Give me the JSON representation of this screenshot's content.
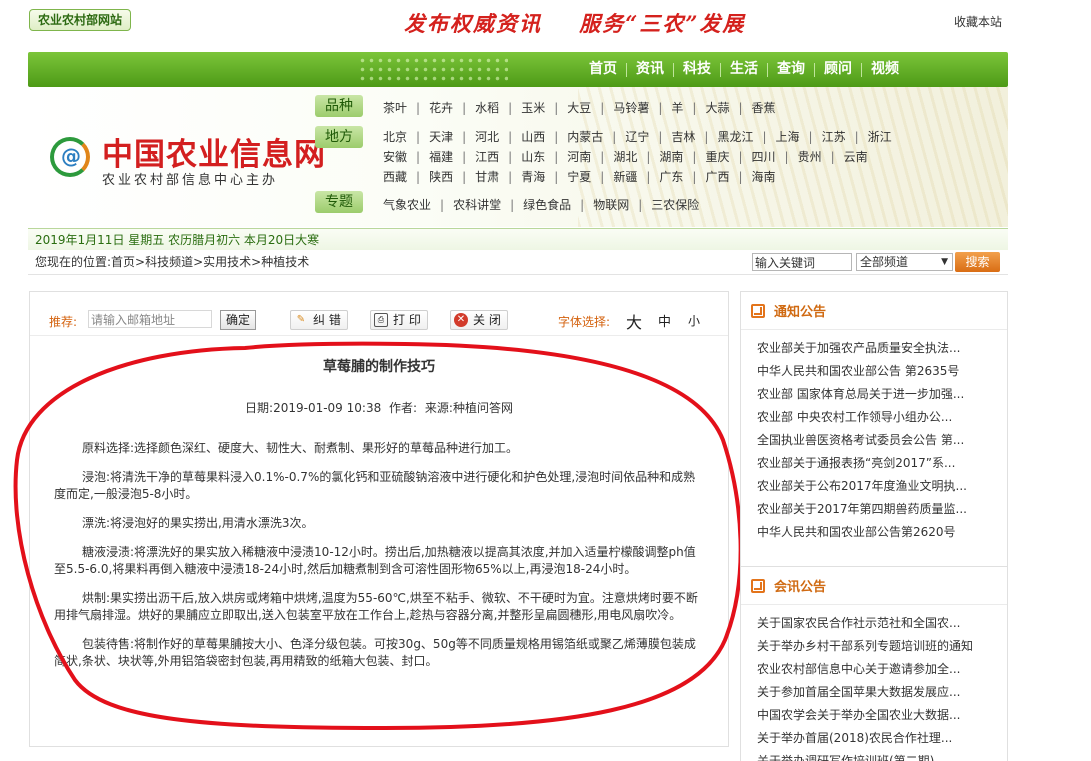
{
  "top": {
    "ministry_link": "农业农村部网站",
    "slogan": "发布权威资讯    服务“三农”发展",
    "bookmark": "收藏本站"
  },
  "nav": [
    "首页",
    "资讯",
    "科技",
    "生活",
    "查询",
    "顾问",
    "视频"
  ],
  "logo": {
    "mark": "@",
    "title": "中国农业信息网",
    "subtitle": "农业农村部信息中心主办"
  },
  "categories": {
    "variety_label": "品种",
    "variety": [
      "茶叶",
      "花卉",
      "水稻",
      "玉米",
      "大豆",
      "马铃薯",
      "羊",
      "大蒜",
      "香蕉"
    ],
    "region_label": "地方",
    "region_row1": [
      "北京",
      "天津",
      "河北",
      "山西",
      "内蒙古",
      "辽宁",
      "吉林",
      "黑龙江",
      "上海",
      "江苏",
      "浙江"
    ],
    "region_row2": [
      "安徽",
      "福建",
      "江西",
      "山东",
      "河南",
      "湖北",
      "湖南",
      "重庆",
      "四川",
      "贵州",
      "云南"
    ],
    "region_row3": [
      "西藏",
      "陕西",
      "甘肃",
      "青海",
      "宁夏",
      "新疆",
      "广东",
      "广西",
      "海南"
    ],
    "topic_label": "专题",
    "topic": [
      "气象农业",
      "农科讲堂",
      "绿色食品",
      "物联网",
      "三农保险"
    ]
  },
  "datebar": "2019年1月11日 星期五 农历腊月初六 本月20日大寒",
  "breadcrumb": "您现在的位置:首页>科技频道>实用技术>种植技术",
  "search": {
    "placeholder": "输入关键词",
    "channel": "全部频道",
    "button": "搜索"
  },
  "tools": {
    "recommend_label": "推荐:",
    "email_placeholder": "请输入邮箱地址",
    "confirm": "确定",
    "error": "纠 错",
    "print": "打 印",
    "close": "关 闭",
    "font_label": "字体选择:",
    "font_large": "大",
    "font_medium": "中",
    "font_small": "小"
  },
  "article": {
    "title": "草莓脯的制作技巧",
    "date": "日期:2019-01-09 10:38",
    "author": "作者:",
    "source": "来源:种植问答网",
    "paragraphs": [
      "原料选择:选择颜色深红、硬度大、韧性大、耐煮制、果形好的草莓品种进行加工。",
      "浸泡:将清洗干净的草莓果料浸入0.1%-0.7%的氯化钙和亚硫酸钠溶液中进行硬化和护色处理,浸泡时间依品种和成熟度而定,一般浸泡5-8小时。",
      "漂洗:将浸泡好的果实捞出,用清水漂洗3次。",
      "糖液浸渍:将漂洗好的果实放入稀糖液中浸渍10-12小时。捞出后,加热糖液以提高其浓度,并加入适量柠檬酸调整ph值至5.5-6.0,将果料再倒入糖液中浸渍18-24小时,然后加糖煮制到含可溶性固形物65%以上,再浸泡18-24小时。",
      "烘制:果实捞出沥干后,放入烘房或烤箱中烘烤,温度为55-60℃,烘至不粘手、微软、不干硬时为宜。注意烘烤时要不断用排气扇排湿。烘好的果脯应立即取出,送入包装室平放在工作台上,趁热与容器分离,并整形呈扁圆穗形,用电风扇吹冷。",
      "包装待售:将制作好的草莓果脯按大小、色泽分级包装。可按30g、50g等不同质量规格用锡箔纸或聚乙烯薄膜包装成简状,条状、块状等,外用铝箔袋密封包装,再用精致的纸箱大包装、封口。"
    ]
  },
  "notice": {
    "title": "通知公告",
    "items": [
      "农业部关于加强农产品质量安全执法...",
      "中华人民共和国农业部公告 第2635号",
      "农业部 国家体育总局关于进一步加强...",
      "农业部 中央农村工作领导小组办公...",
      "全国执业兽医资格考试委员会公告 第...",
      "农业部关于通报表扬“亮剑2017”系...",
      "农业部关于公布2017年度渔业文明执...",
      "农业部关于2017年第四期兽药质量监...",
      "中华人民共和国农业部公告第2620号"
    ]
  },
  "meeting": {
    "title": "会讯公告",
    "items": [
      "关于国家农民合作社示范社和全国农...",
      "关于举办乡村干部系列专题培训班的通知",
      "农业农村部信息中心关于邀请参加全...",
      "关于参加首届全国苹果大数据发展应...",
      "中国农学会关于举办全国农业大数据...",
      "关于举办首届(2018)农民合作社理...",
      "关于举办调研写作培训班(第二期)"
    ]
  },
  "colors": {
    "nav_green": "#5aa822",
    "brand_red": "#d31f1f",
    "accent_orange": "#d96d14",
    "annotation_red": "#e3101a"
  }
}
